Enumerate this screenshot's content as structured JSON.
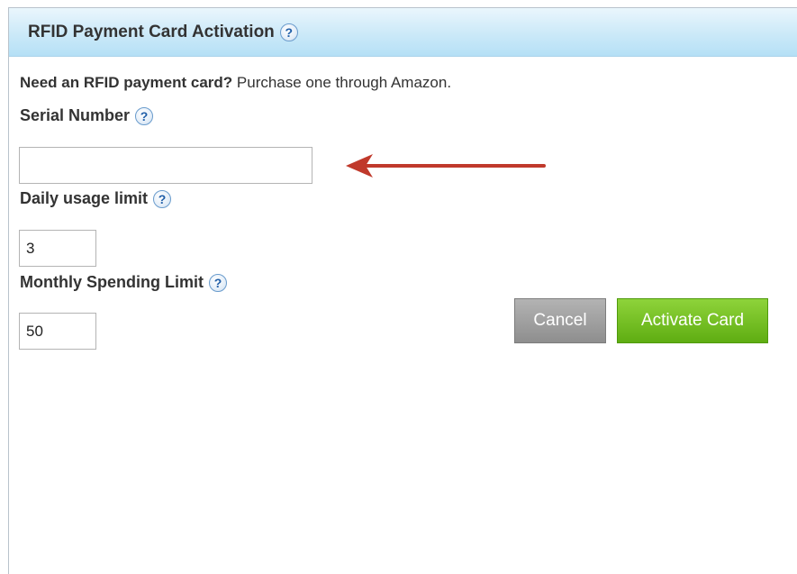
{
  "panel": {
    "title": "RFID Payment Card Activation",
    "help_glyph": "?"
  },
  "intro": {
    "bold_text": "Need an RFID payment card?",
    "text": " Purchase one through Amazon."
  },
  "fields": {
    "serial_number": {
      "label": "Serial Number",
      "value": ""
    },
    "daily_usage_limit": {
      "label": "Daily usage limit",
      "value": "3"
    },
    "monthly_spending_limit": {
      "label": "Monthly Spending Limit",
      "value": "50"
    }
  },
  "buttons": {
    "cancel": "Cancel",
    "activate": "Activate Card"
  },
  "annotation": {
    "arrow_color": "#c0392b",
    "icon": "left-arrow-icon"
  },
  "colors": {
    "header_bg": "#cbe9f8",
    "cancel_bg": "#9e9e9e",
    "activate_bg": "#6cbd1c"
  }
}
